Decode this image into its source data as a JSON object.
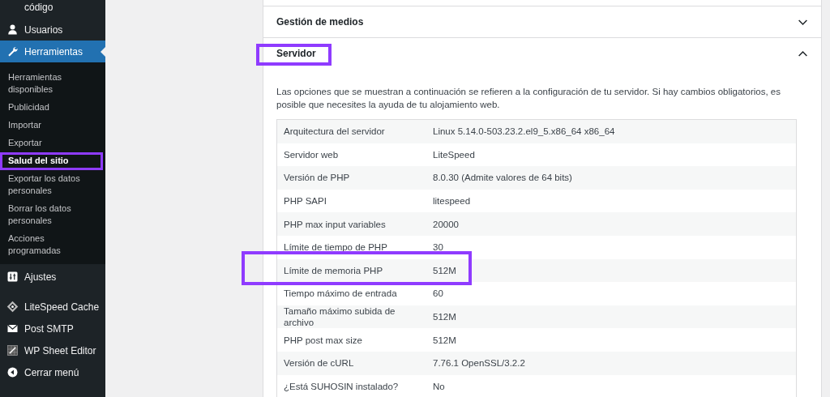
{
  "sidebar": {
    "items": [
      {
        "label": "código",
        "selected": false,
        "kind": "cut"
      },
      {
        "label": "Usuarios",
        "selected": false,
        "kind": "user"
      },
      {
        "label": "Herramientas",
        "selected": true,
        "kind": "wrench",
        "children": [
          {
            "label": "Herramientas disponibles",
            "selected": false,
            "highlighted": false
          },
          {
            "label": "Publicidad",
            "selected": false,
            "highlighted": false
          },
          {
            "label": "Importar",
            "selected": false,
            "highlighted": false
          },
          {
            "label": "Exportar",
            "selected": false,
            "highlighted": false
          },
          {
            "label": "Salud del sitio",
            "selected": true,
            "highlighted": true
          },
          {
            "label": "Exportar los datos personales",
            "selected": false,
            "highlighted": false
          },
          {
            "label": "Borrar los datos personales",
            "selected": false,
            "highlighted": false
          },
          {
            "label": "Acciones programadas",
            "selected": false,
            "highlighted": false
          }
        ]
      },
      {
        "label": "Ajustes",
        "selected": false,
        "kind": "sliders"
      },
      {
        "label": "LiteSpeed Cache",
        "selected": false,
        "kind": "diamond"
      },
      {
        "label": "Post SMTP",
        "selected": false,
        "kind": "envelope"
      },
      {
        "label": "WP Sheet Editor",
        "selected": false,
        "kind": "sheet"
      },
      {
        "label": "Cerrar menú",
        "selected": false,
        "kind": "collapse"
      }
    ]
  },
  "sections": [
    {
      "title": "Gestión de medios",
      "expanded": false,
      "highlighted": false
    },
    {
      "title": "Servidor",
      "expanded": true,
      "highlighted": true,
      "description": "Las opciones que se muestran a continuación se refieren a la configuración de tu servidor. Si hay cambios obligatorios, es posible que necesites la ayuda de tu alojamiento web.",
      "table": {
        "rows": [
          {
            "label": "Arquitectura del servidor",
            "value": "Linux 5.14.0-503.23.2.el9_5.x86_64 x86_64",
            "highlighted": false
          },
          {
            "label": "Servidor web",
            "value": "LiteSpeed",
            "highlighted": false
          },
          {
            "label": "Versión de PHP",
            "value": "8.0.30 (Admite valores de 64 bits)",
            "highlighted": false
          },
          {
            "label": "PHP SAPI",
            "value": "litespeed",
            "highlighted": false
          },
          {
            "label": "PHP max input variables",
            "value": "20000",
            "highlighted": false
          },
          {
            "label": "Límite de tiempo de PHP",
            "value": "30",
            "highlighted": false
          },
          {
            "label": "Límite de memoria PHP",
            "value": "512M",
            "highlighted": true
          },
          {
            "label": "Tiempo máximo de entrada",
            "value": "60",
            "highlighted": false
          },
          {
            "label": "Tamaño máximo subida de archivo",
            "value": "512M",
            "highlighted": false
          },
          {
            "label": "PHP post max size",
            "value": "512M",
            "highlighted": false
          },
          {
            "label": "Versión de cURL",
            "value": "7.76.1 OpenSSL/3.2.2",
            "highlighted": false
          },
          {
            "label": "¿Está SUHOSIN instalado?",
            "value": "No",
            "highlighted": false
          }
        ]
      }
    }
  ]
}
